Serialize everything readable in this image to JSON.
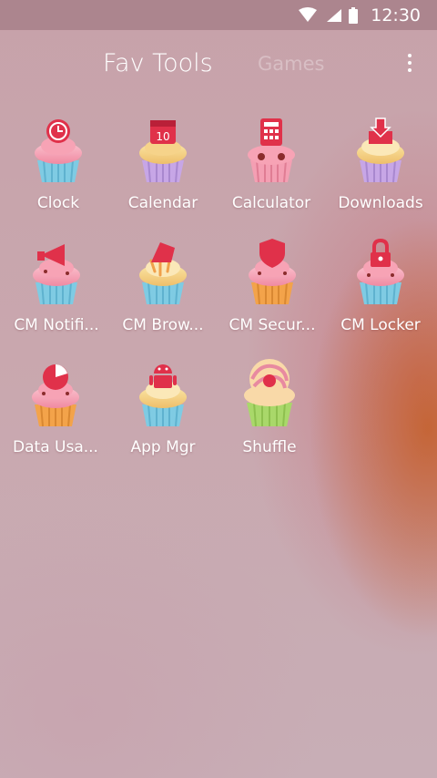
{
  "status_bar": {
    "time": "12:30",
    "icons": [
      "wifi-icon",
      "signal-icon",
      "battery-icon"
    ]
  },
  "tabs": [
    {
      "label": "Fav Tools",
      "active": true
    },
    {
      "label": "Games",
      "active": false
    }
  ],
  "apps": [
    {
      "label": "Clock",
      "icon": "clock-icon"
    },
    {
      "label": "Calendar",
      "icon": "calendar-icon",
      "badge": "10"
    },
    {
      "label": "Calculator",
      "icon": "calculator-icon"
    },
    {
      "label": "Downloads",
      "icon": "download-icon"
    },
    {
      "label": "CM Notifi...",
      "icon": "megaphone-icon"
    },
    {
      "label": "CM Brow...",
      "icon": "browser-icon"
    },
    {
      "label": "CM Secur...",
      "icon": "shield-icon"
    },
    {
      "label": "CM Locker",
      "icon": "lock-icon"
    },
    {
      "label": "Data Usa...",
      "icon": "pie-chart-icon"
    },
    {
      "label": "App Mgr",
      "icon": "android-icon"
    },
    {
      "label": "Shuffle",
      "icon": "shuffle-icon"
    }
  ],
  "colors": {
    "accent_red": "#e0314a",
    "frosting_pink": "#f7a3b5",
    "cup_blue": "#7fcbe3",
    "cup_purple": "#c7a6e6",
    "cup_orange": "#f3a34a",
    "cup_green": "#a9d86a",
    "cake_yellow": "#f6d38a"
  }
}
